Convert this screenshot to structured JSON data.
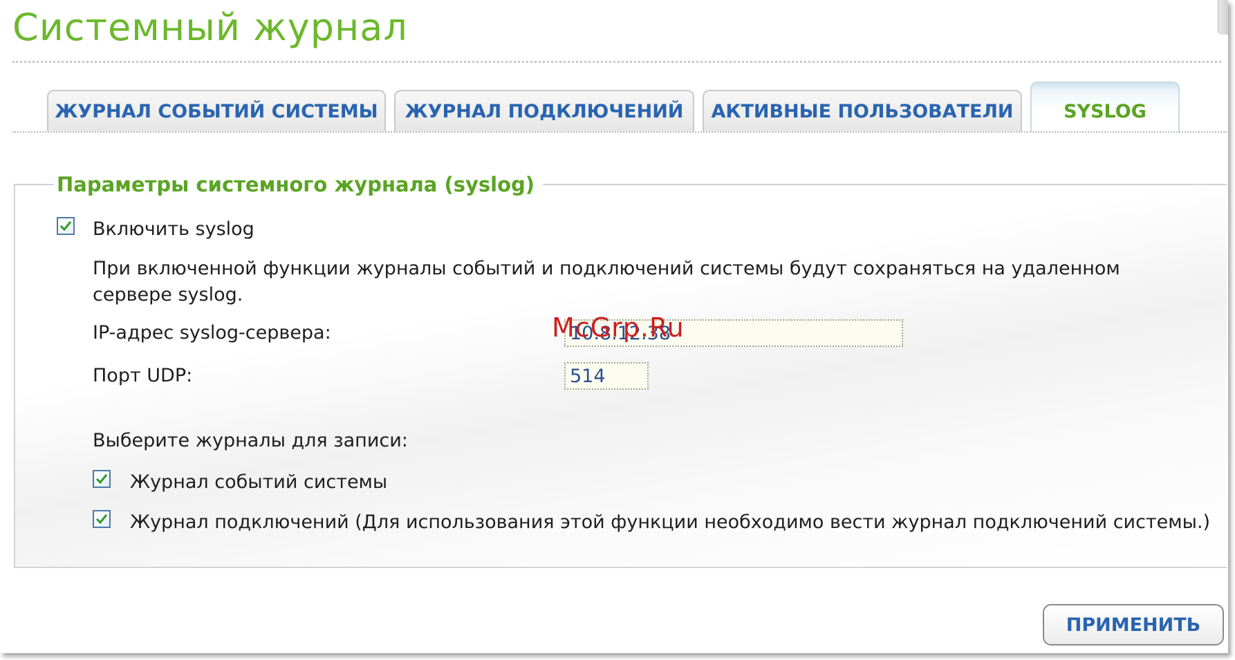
{
  "page": {
    "title": "Системный журнал"
  },
  "tabs": [
    {
      "label": "ЖУРНАЛ СОБЫТИЙ СИСТЕМЫ",
      "active": false
    },
    {
      "label": "ЖУРНАЛ ПОДКЛЮЧЕНИЙ",
      "active": false
    },
    {
      "label": "АКТИВНЫЕ ПОЛЬЗОВАТЕЛИ",
      "active": false
    },
    {
      "label": "SYSLOG",
      "active": true
    }
  ],
  "syslog": {
    "legend": "Параметры системного журнала (syslog)",
    "enable_label": "Включить syslog",
    "enable_checked": true,
    "description": "При включенной функции журналы событий и подключений системы будут сохраняться на удаленном сервере syslog.",
    "server_ip_label": "IP-адрес syslog-сервера:",
    "server_ip_value": "10.8.12.38",
    "udp_port_label": "Порт UDP:",
    "udp_port_value": "514",
    "choose_logs_label": "Выберите журналы для записи:",
    "log_system_events_label": "Журнал событий системы",
    "log_system_events_checked": true,
    "log_connections_label": "Журнал подключений (Для использования этой функции необходимо вести журнал подключений системы.)",
    "log_connections_checked": true
  },
  "actions": {
    "apply_label": "ПРИМЕНИТЬ"
  },
  "watermark": "McGrp.Ru",
  "colors": {
    "title_green": "#6cb82c",
    "tab_blue": "#2a64b0",
    "legend_green": "#5aa423",
    "watermark_red": "#cc1f1f"
  }
}
